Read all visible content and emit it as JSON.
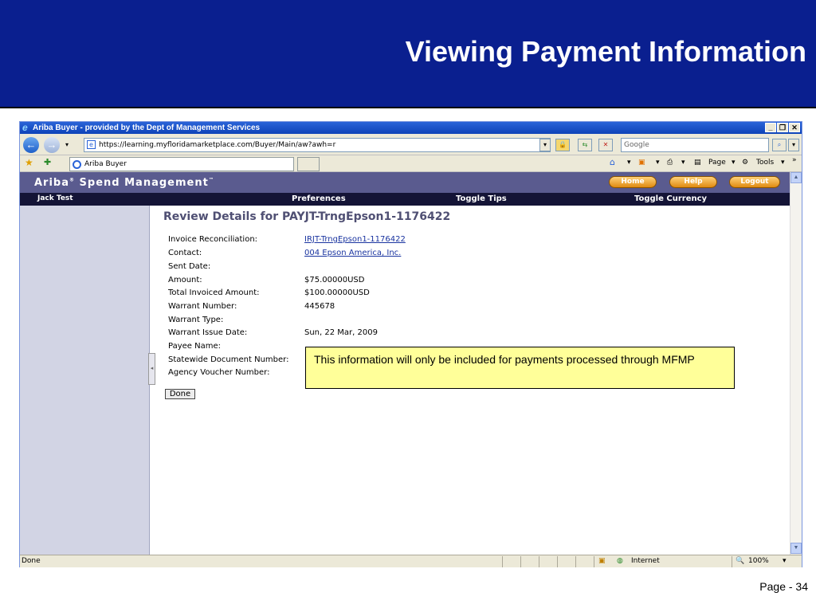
{
  "slide": {
    "title": "Viewing Payment Information",
    "page": "Page - 34"
  },
  "browser": {
    "window_title": "Ariba Buyer - provided by the Dept of Management Services",
    "url": "https://learning.myfloridamarketplace.com/Buyer/Main/aw?awh=r",
    "search_placeholder": "Google",
    "tab_label": "Ariba Buyer",
    "toolbar": {
      "page_label": "Page",
      "tools_label": "Tools"
    },
    "status": {
      "left": "Done",
      "zone": "Internet",
      "zoom": "100%"
    }
  },
  "ariba": {
    "logo": "Ariba",
    "logo_suffix": "Spend Management",
    "buttons": {
      "home": "Home",
      "help": "Help",
      "logout": "Logout"
    },
    "nav": {
      "user": "Jack Test",
      "preferences": "Preferences",
      "toggle_tips": "Toggle Tips",
      "toggle_currency": "Toggle Currency"
    }
  },
  "details": {
    "title": "Review Details for PAYJT-TrngEpson1-1176422",
    "fields": [
      {
        "label": "Invoice Reconciliation:",
        "value": "IRJT-TrngEpson1-1176422",
        "link": true
      },
      {
        "label": "Contact:",
        "value": "004  Epson America, Inc.",
        "link": true
      },
      {
        "label": "Sent Date:",
        "value": ""
      },
      {
        "label": "Amount:",
        "value": "$75.00000USD"
      },
      {
        "label": "Total Invoiced Amount:",
        "value": "$100.00000USD"
      },
      {
        "label": "Warrant Number:",
        "value": "445678"
      },
      {
        "label": "Warrant Type:",
        "value": ""
      },
      {
        "label": "Warrant Issue Date:",
        "value": "Sun, 22 Mar, 2009"
      },
      {
        "label": "Payee Name:",
        "value": ""
      },
      {
        "label": "Statewide Document Number:",
        "value": ""
      },
      {
        "label": "Agency Voucher Number:",
        "value": ""
      }
    ],
    "done_label": "Done"
  },
  "callout": "This information will only be included for payments processed through MFMP"
}
